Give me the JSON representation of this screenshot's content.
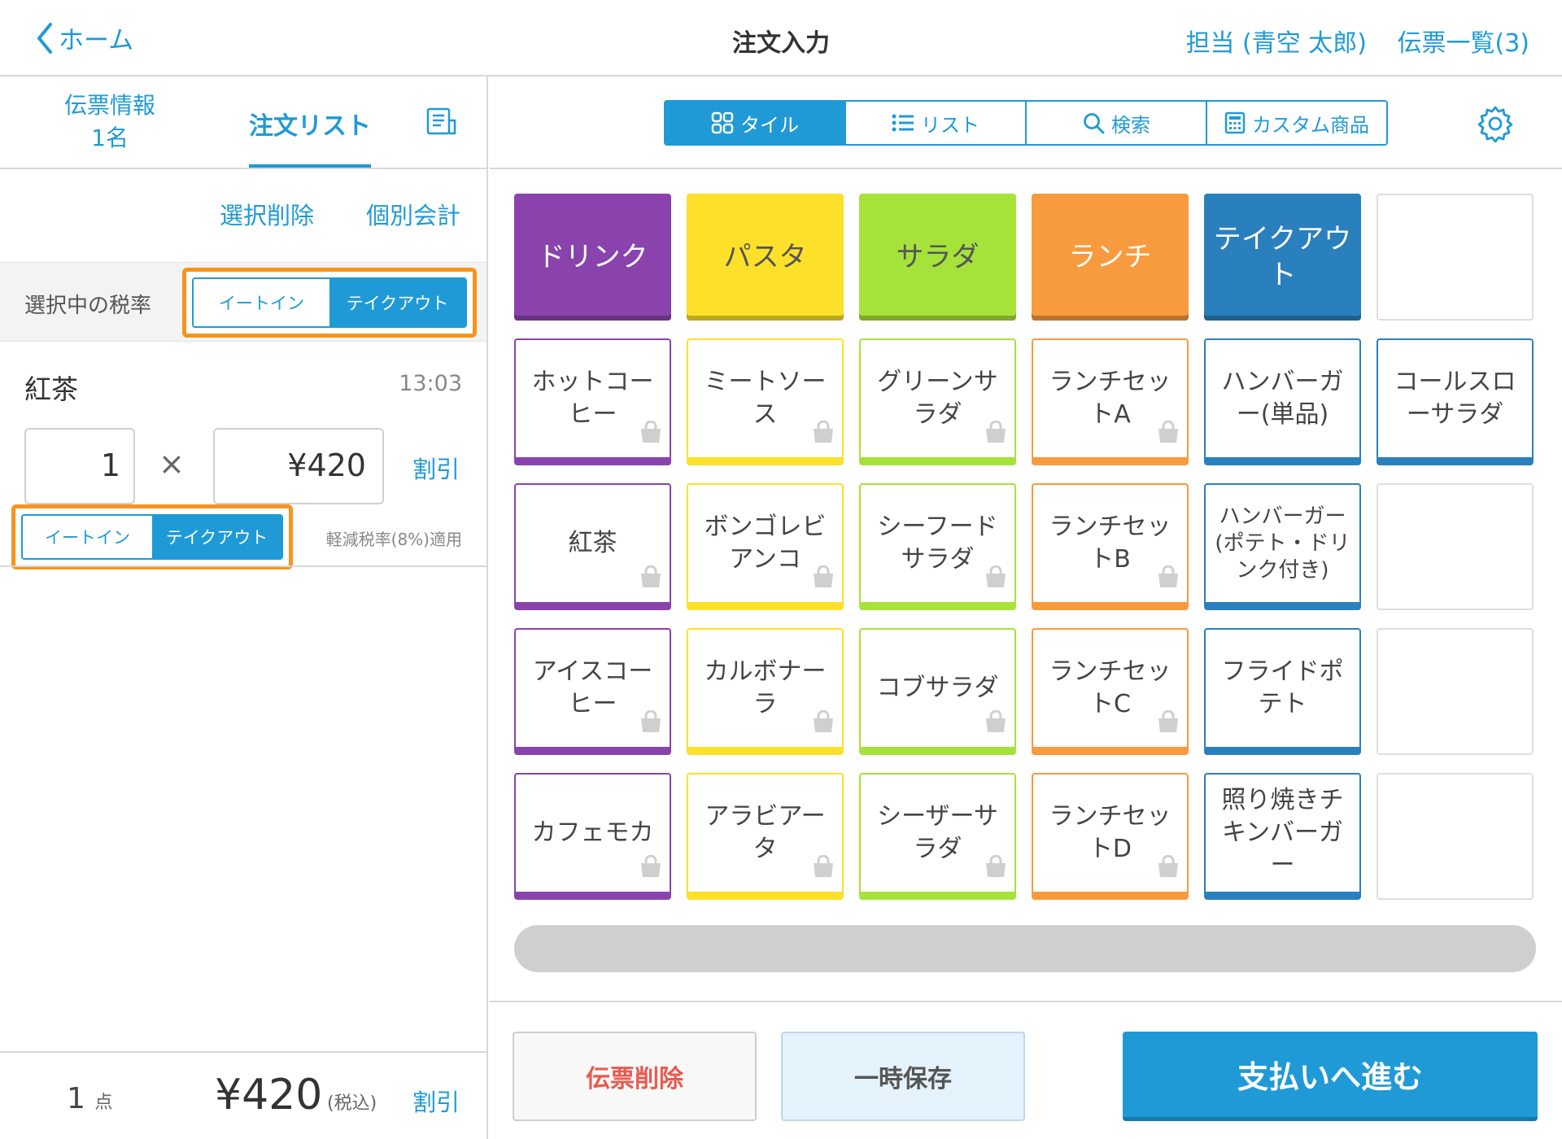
{
  "header": {
    "back_label": "ホーム",
    "title": "注文入力",
    "staff": "担当 (青空 太郎)",
    "ticket_list": "伝票一覧(3)"
  },
  "left": {
    "tabs": {
      "info_line1": "伝票情報",
      "info_line2": "1名",
      "order_list": "注文リスト"
    },
    "actions": {
      "delete_selected": "選択削除",
      "split_payment": "個別会計"
    },
    "tax_rate_label": "選択中の税率",
    "tax_options": [
      "イートイン",
      "テイクアウト"
    ],
    "tax_selected": "テイクアウト",
    "item": {
      "name": "紅茶",
      "time": "13:03",
      "quantity": "1",
      "times_sign": "×",
      "price": "¥420",
      "discount": "割引",
      "tax_options": [
        "イートイン",
        "テイクアウト"
      ],
      "tax_selected": "テイクアウト",
      "reduced_tax_note": "軽減税率(8%)適用"
    },
    "footer": {
      "count": "1",
      "count_unit": "点",
      "total": "¥420",
      "tax_note": "(税込)",
      "discount": "割引"
    }
  },
  "right": {
    "view_tabs": [
      "タイル",
      "リスト",
      "検索",
      "カスタム商品"
    ],
    "view_selected": "タイル",
    "categories": [
      {
        "label": "ドリンク",
        "color": "#8a43ad"
      },
      {
        "label": "パスタ",
        "color": "#fde02a"
      },
      {
        "label": "サラダ",
        "color": "#a6e33a"
      },
      {
        "label": "ランチ",
        "color": "#f89a3e"
      },
      {
        "label": "テイクアウト",
        "color": "#2a80bd"
      }
    ],
    "products": [
      [
        "ホットコーヒー",
        "ミートソース",
        "グリーンサラダ",
        "ランチセットA",
        "ハンバーガー(単品)",
        "コールスローサラダ"
      ],
      [
        "紅茶",
        "ボンゴレビアンコ",
        "シーフードサラダ",
        "ランチセットB",
        "ハンバーガー(ポテト・ドリンク付き)",
        ""
      ],
      [
        "アイスコーヒー",
        "カルボナーラ",
        "コブサラダ",
        "ランチセットC",
        "フライドポテト",
        ""
      ],
      [
        "カフェモカ",
        "アラビアータ",
        "シーザーサラダ",
        "ランチセットD",
        "照り焼きチキンバーガー",
        ""
      ]
    ],
    "column_colors": [
      "#8a43ad",
      "#fde02a",
      "#a6e33a",
      "#f89a3e",
      "#2a80bd",
      "#2a80bd"
    ],
    "footer": {
      "delete_ticket": "伝票削除",
      "hold": "一時保存",
      "proceed_payment": "支払いへ進む"
    }
  }
}
